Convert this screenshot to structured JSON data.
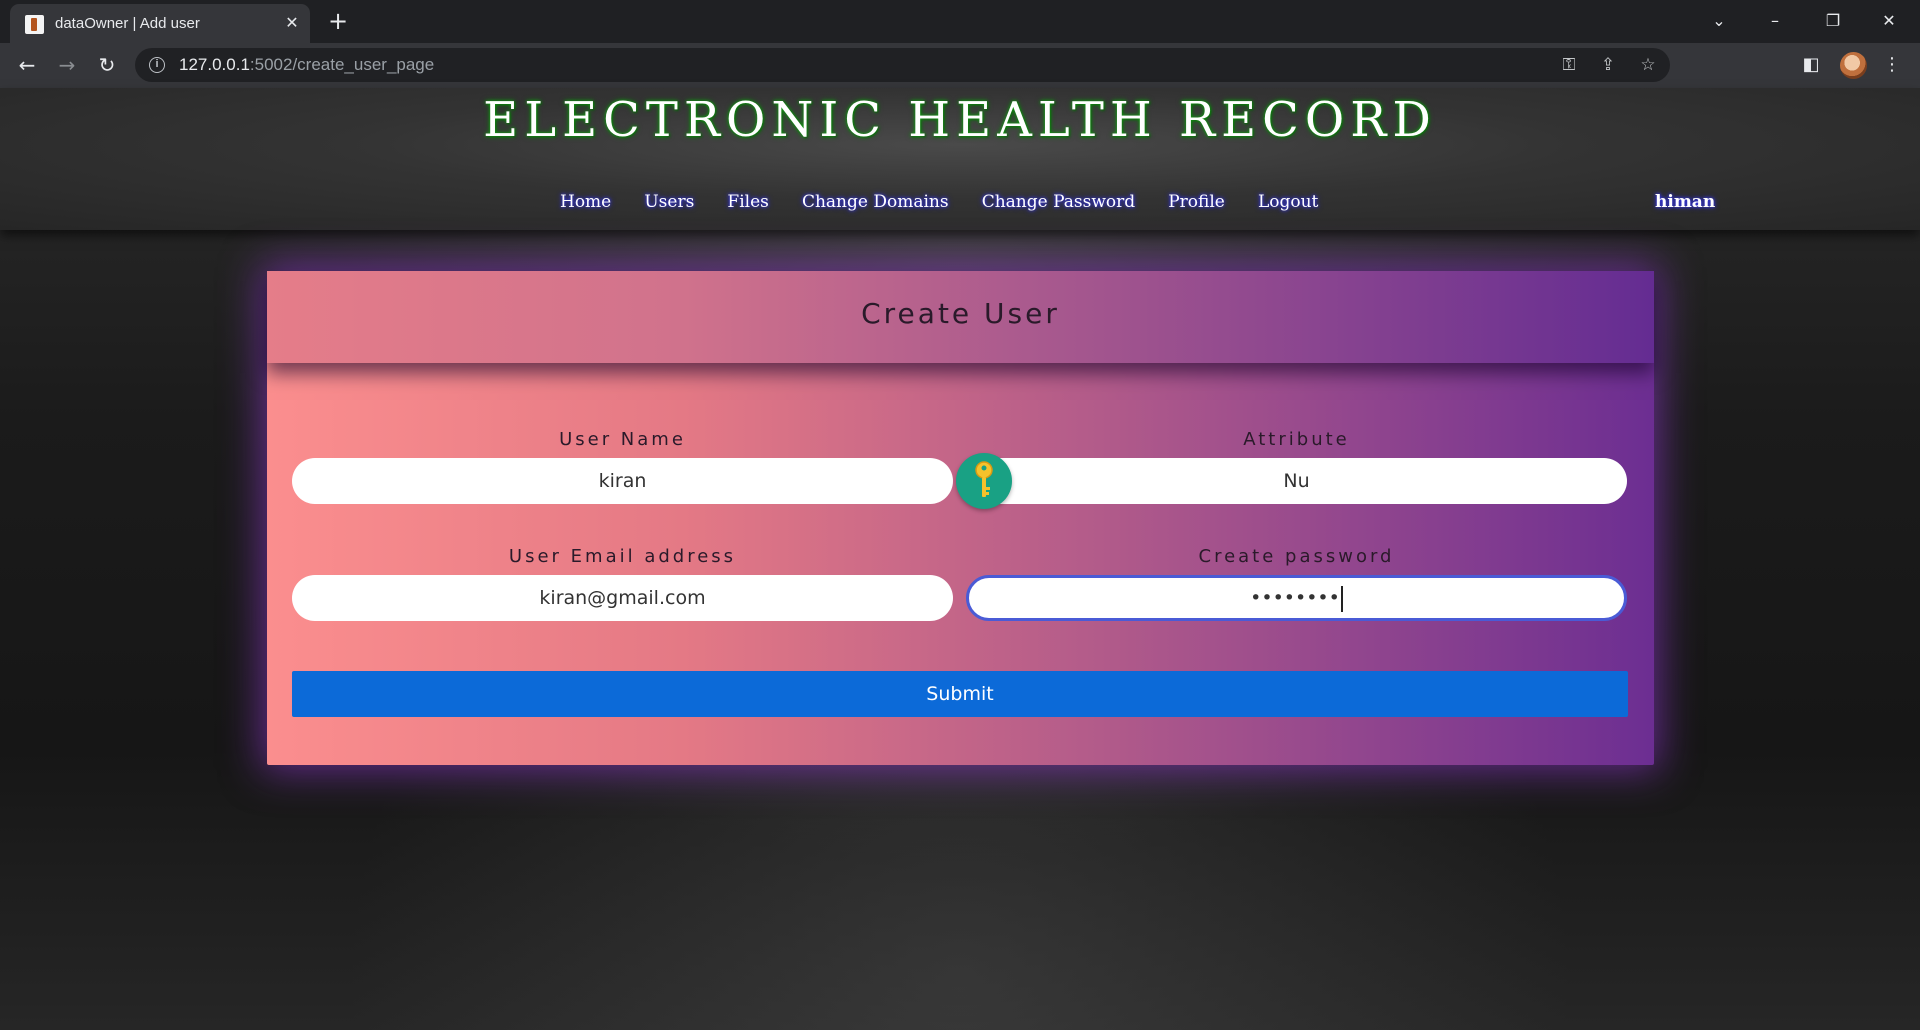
{
  "browser": {
    "tab_title": "dataOwner | Add user",
    "url_host": "127.0.0.1",
    "url_path": ":5002/create_user_page"
  },
  "site": {
    "title": "ELECTRONIC HEALTH RECORD",
    "nav": [
      "Home",
      "Users",
      "Files",
      "Change Domains",
      "Change Password",
      "Profile",
      "Logout"
    ],
    "user": "himan"
  },
  "form": {
    "title": "Create User",
    "user_name_label": "User Name",
    "user_name_value": "kiran",
    "attribute_label": "Attribute",
    "attribute_value": "Nu",
    "email_label": "User Email address",
    "email_value": "kiran@gmail.com",
    "password_label": "Create password",
    "password_value": "••••••••",
    "submit_label": "Submit"
  },
  "colors": {
    "submit": "#0c6ad8",
    "key_badge": "#19a184",
    "focus_ring": "#4a5bd6"
  }
}
